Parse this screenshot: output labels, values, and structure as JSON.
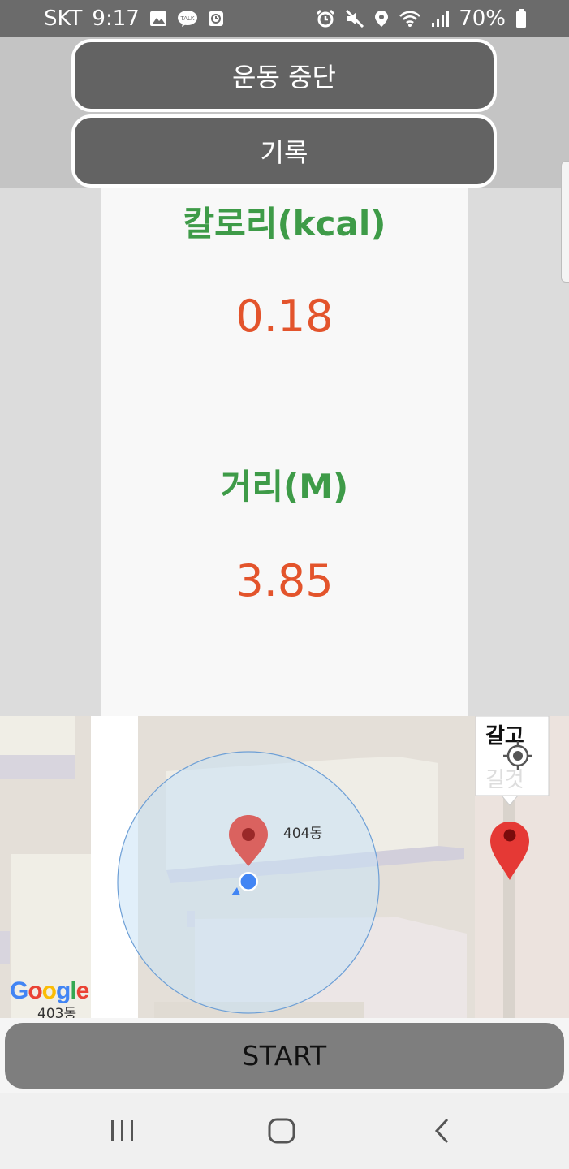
{
  "status_bar": {
    "carrier": "SKT",
    "time": "9:17",
    "battery": "70%",
    "left_icons": [
      "gallery-icon",
      "kakaotalk-icon",
      "screen-recorder-icon"
    ],
    "right_icons": [
      "alarm-icon",
      "mute-icon",
      "location-icon",
      "wifi-icon",
      "signal-icon",
      "battery-icon"
    ]
  },
  "buttons": {
    "stop_label": "운동 중단",
    "record_label": "기록",
    "start_label": "START"
  },
  "stats": {
    "calorie_label": "칼로리(kcal)",
    "calorie_value": "0.18",
    "distance_label": "거리(M)",
    "distance_value": "3.85"
  },
  "map": {
    "building_labels": [
      "404동",
      "403동"
    ],
    "poi_label": "갈고",
    "poi_label_faded": "길것",
    "provider": "Google",
    "marker_color": "#e53935",
    "location_dot_color": "#4285f4"
  },
  "colors": {
    "label_green": "#3e9b48",
    "value_orange": "#e3542c"
  },
  "nav_bar": {
    "icons": [
      "recent-apps-icon",
      "home-icon",
      "back-icon"
    ]
  }
}
